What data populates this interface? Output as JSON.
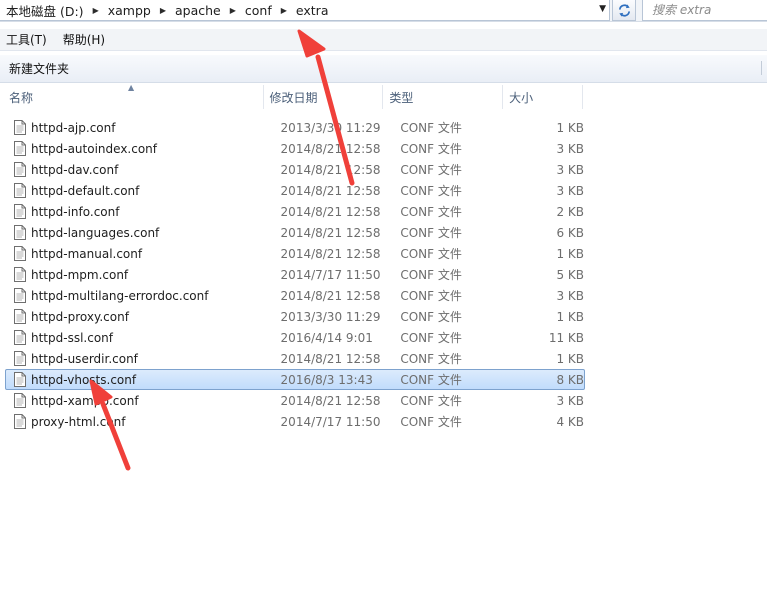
{
  "address": {
    "crumbs": [
      "本地磁盘 (D:)",
      "xampp",
      "apache",
      "conf",
      "extra"
    ]
  },
  "search": {
    "placeholder": "搜索 extra"
  },
  "menu": {
    "items": [
      "工具(T)",
      "帮助(H)"
    ]
  },
  "toolbar": {
    "new_folder": "新建文件夹"
  },
  "columns": {
    "name": "名称",
    "date": "修改日期",
    "type": "类型",
    "size": "大小"
  },
  "files": [
    {
      "name": "httpd-ajp.conf",
      "date": "2013/3/30 11:29",
      "type": "CONF 文件",
      "size": "1 KB"
    },
    {
      "name": "httpd-autoindex.conf",
      "date": "2014/8/21 12:58",
      "type": "CONF 文件",
      "size": "3 KB"
    },
    {
      "name": "httpd-dav.conf",
      "date": "2014/8/21 12:58",
      "type": "CONF 文件",
      "size": "3 KB"
    },
    {
      "name": "httpd-default.conf",
      "date": "2014/8/21 12:58",
      "type": "CONF 文件",
      "size": "3 KB"
    },
    {
      "name": "httpd-info.conf",
      "date": "2014/8/21 12:58",
      "type": "CONF 文件",
      "size": "2 KB"
    },
    {
      "name": "httpd-languages.conf",
      "date": "2014/8/21 12:58",
      "type": "CONF 文件",
      "size": "6 KB"
    },
    {
      "name": "httpd-manual.conf",
      "date": "2014/8/21 12:58",
      "type": "CONF 文件",
      "size": "1 KB"
    },
    {
      "name": "httpd-mpm.conf",
      "date": "2014/7/17 11:50",
      "type": "CONF 文件",
      "size": "5 KB"
    },
    {
      "name": "httpd-multilang-errordoc.conf",
      "date": "2014/8/21 12:58",
      "type": "CONF 文件",
      "size": "3 KB"
    },
    {
      "name": "httpd-proxy.conf",
      "date": "2013/3/30 11:29",
      "type": "CONF 文件",
      "size": "1 KB"
    },
    {
      "name": "httpd-ssl.conf",
      "date": "2016/4/14 9:01",
      "type": "CONF 文件",
      "size": "11 KB"
    },
    {
      "name": "httpd-userdir.conf",
      "date": "2014/8/21 12:58",
      "type": "CONF 文件",
      "size": "1 KB"
    },
    {
      "name": "httpd-vhosts.conf",
      "date": "2016/8/3 13:43",
      "type": "CONF 文件",
      "size": "8 KB"
    },
    {
      "name": "httpd-xampp.conf",
      "date": "2014/8/21 12:58",
      "type": "CONF 文件",
      "size": "3 KB"
    },
    {
      "name": "proxy-html.conf",
      "date": "2014/7/17 11:50",
      "type": "CONF 文件",
      "size": "4 KB"
    }
  ],
  "selected_file": "httpd-vhosts.conf",
  "colors": {
    "selection": "#cce3fb",
    "annotation_arrow": "#f0403a"
  },
  "icons": {
    "breadcrumb_separator": "triangle-right-icon",
    "refresh": "refresh-icon",
    "file": "document-icon"
  }
}
